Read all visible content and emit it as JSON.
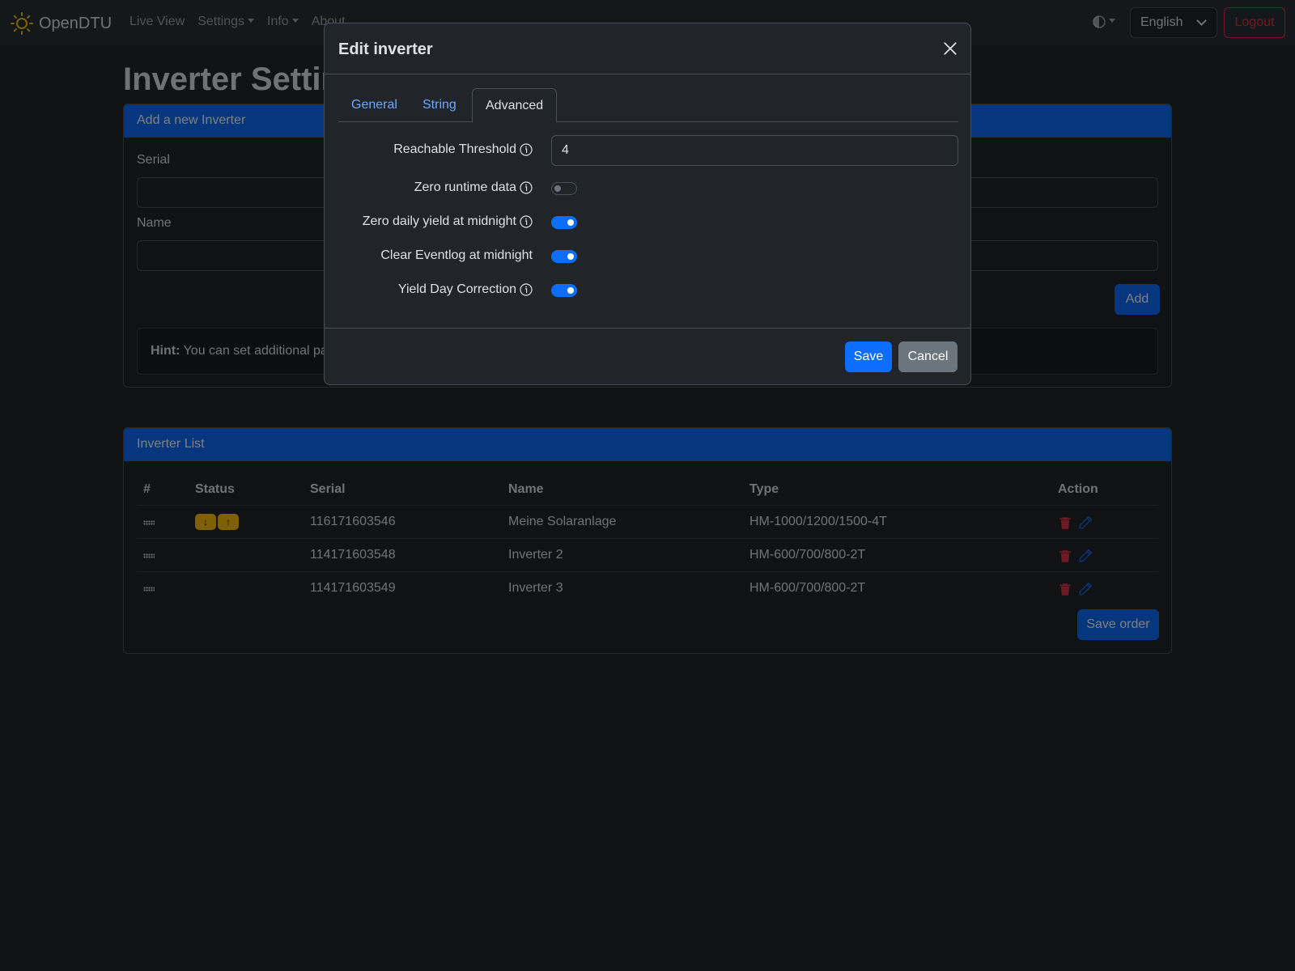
{
  "navbar": {
    "brand": "OpenDTU",
    "items": [
      {
        "label": "Live View",
        "dropdown": false
      },
      {
        "label": "Settings",
        "dropdown": true
      },
      {
        "label": "Info",
        "dropdown": true
      },
      {
        "label": "About",
        "dropdown": false
      }
    ],
    "theme_icon": "contrast-icon",
    "language": "English",
    "logout_label": "Logout"
  },
  "page": {
    "title": "Inverter Settings"
  },
  "add_card": {
    "header": "Add a new Inverter",
    "serial_label": "Serial",
    "name_label": "Name",
    "add_label": "Add",
    "hint_bold": "Hint:",
    "hint_text": "You can set additional pa"
  },
  "list_card": {
    "header": "Inverter List",
    "columns": [
      "#",
      "Status",
      "Serial",
      "Name",
      "Type",
      "Action"
    ],
    "rows": [
      {
        "serial": "116171603546",
        "name": "Meine Solaranlage",
        "type": "HM-1000/1200/1500-4T",
        "status_badges": [
          "↓",
          "↑"
        ]
      },
      {
        "serial": "114171603548",
        "name": "Inverter 2",
        "type": "HM-600/700/800-2T",
        "status_badges": []
      },
      {
        "serial": "114171603549",
        "name": "Inverter 3",
        "type": "HM-600/700/800-2T",
        "status_badges": []
      }
    ],
    "save_order_label": "Save order"
  },
  "modal": {
    "title": "Edit inverter",
    "tabs": [
      {
        "label": "General",
        "active": false
      },
      {
        "label": "String",
        "active": false
      },
      {
        "label": "Advanced",
        "active": true
      }
    ],
    "fields": {
      "reachable_threshold_label": "Reachable Threshold",
      "reachable_threshold_value": "4",
      "zero_runtime_label": "Zero runtime data",
      "zero_runtime_on": false,
      "zero_daily_label": "Zero daily yield at midnight",
      "zero_daily_on": true,
      "clear_eventlog_label": "Clear Eventlog at midnight",
      "clear_eventlog_on": true,
      "yield_day_label": "Yield Day Correction",
      "yield_day_on": true
    },
    "save_label": "Save",
    "cancel_label": "Cancel"
  },
  "colors": {
    "primary": "#0d6efd",
    "danger": "#dc3545",
    "warning": "#ffc107",
    "secondary": "#6c757d"
  }
}
